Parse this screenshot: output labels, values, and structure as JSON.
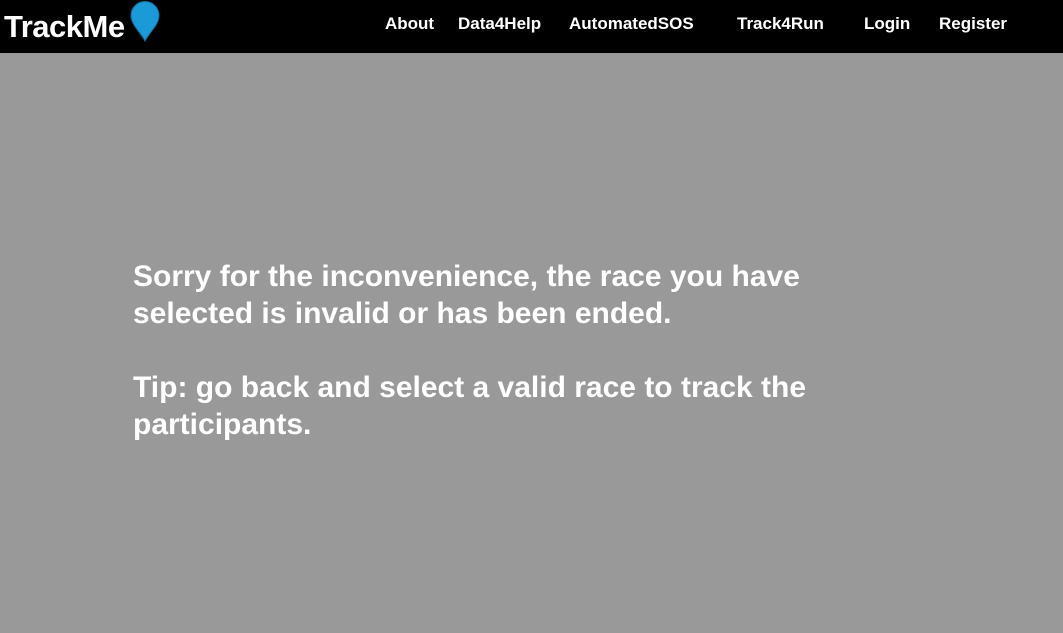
{
  "navbar": {
    "brand": {
      "text": "TrackMe",
      "pin_icon": "map-pin-icon",
      "pin_color": "#1a9ad6"
    },
    "links": [
      {
        "label": "About"
      },
      {
        "label": "Data4Help"
      },
      {
        "label": "AutomatedSOS"
      },
      {
        "label": "Track4Run"
      },
      {
        "label": "Login"
      },
      {
        "label": "Register"
      }
    ],
    "background": "#000000"
  },
  "main": {
    "background": "#999999",
    "error_message": "Sorry for the inconvenience, the race you have selected is invalid or has been ended.",
    "tip_message": "Tip: go back and select a valid race to track the participants."
  }
}
